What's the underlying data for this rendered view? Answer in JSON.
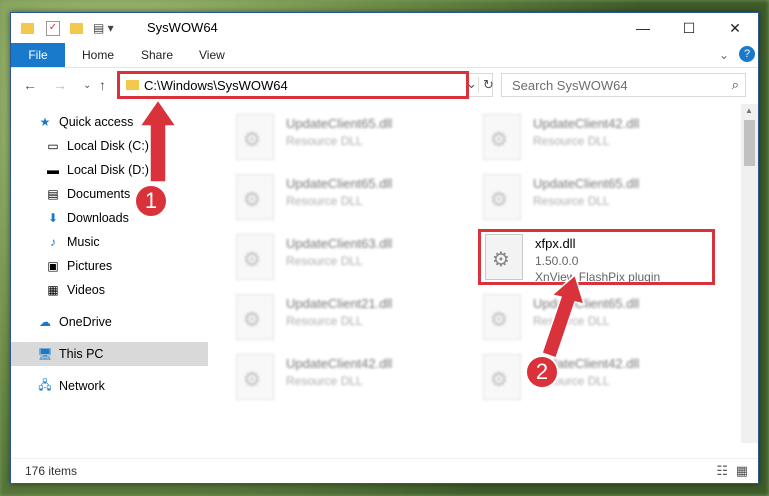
{
  "window": {
    "title": "SysWOW64"
  },
  "ribbon": {
    "tabs": [
      "File",
      "Home",
      "Share",
      "View"
    ]
  },
  "nav": {
    "address": "C:\\Windows\\SysWOW64",
    "search_placeholder": "Search SysWOW64"
  },
  "sidebar": {
    "quick_access": "Quick access",
    "items": [
      "Local Disk (C:)",
      "Local Disk (D:)",
      "Documents",
      "Downloads",
      "Music",
      "Pictures",
      "Videos"
    ],
    "onedrive": "OneDrive",
    "thispc": "This PC",
    "network": "Network"
  },
  "files": [
    {
      "name": "UpdateClient65.dll",
      "desc": "Resource DLL"
    },
    {
      "name": "UpdateClient42.dll",
      "desc": "Resource DLL"
    },
    {
      "name": "UpdateClient65.dll",
      "desc": "Resource DLL"
    },
    {
      "name": "UpdateClient65.dll",
      "desc": "Resource DLL"
    },
    {
      "name": "UpdateClient63.dll",
      "desc": "Resource DLL"
    },
    {
      "name": "xfpx.dll",
      "desc": "1.50.0.0",
      "desc2": "XnView FlashPix plugin"
    },
    {
      "name": "UpdateClient21.dll",
      "desc": "Resource DLL"
    },
    {
      "name": "UpdateClient65.dll",
      "desc": "Resource DLL"
    },
    {
      "name": "UpdateClient42.dll",
      "desc": "Resource DLL"
    },
    {
      "name": "UpdateClient42.dll",
      "desc": "Resource DLL"
    }
  ],
  "status": {
    "items": "176 items"
  },
  "annotations": {
    "step1": "1",
    "step2": "2"
  },
  "colors": {
    "accent": "#1979ca",
    "highlight": "#d9323a"
  }
}
